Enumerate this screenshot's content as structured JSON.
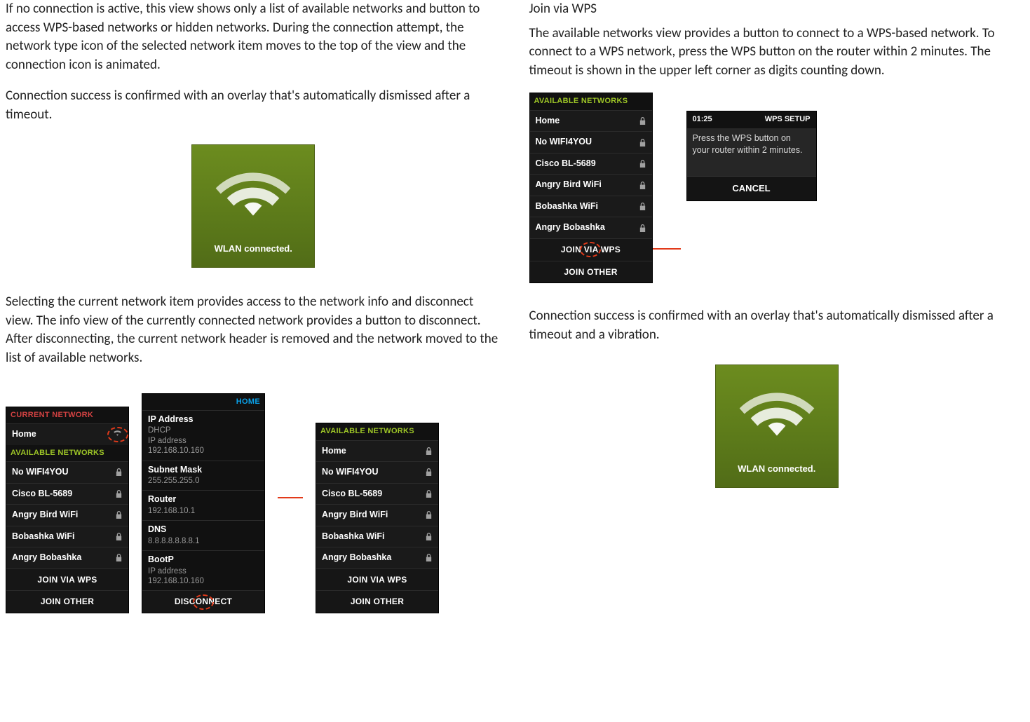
{
  "left": {
    "p1": "If no connection is active, this view shows only a list of available networks and button to access WPS-based networks or hidden networks. During the connection attempt, the network type icon of the selected network item moves to the top of the view and the connection icon is animated.",
    "p2": "Connection success is confirmed with an overlay that's automatically dismissed after a timeout.",
    "p3": "Selecting the current network item provides access to the network info and disconnect view. The info view of the currently connected network provides a button to disconnect. After disconnecting, the current network header is removed and the network moved to the list of available networks."
  },
  "wlan_connected_caption": "WLAN connected.",
  "phone_current": {
    "header_current": "CURRENT NETWORK",
    "current_item": "Home",
    "header_available": "AVAILABLE NETWORKS",
    "items": [
      "No WIFI4YOU",
      "Cisco BL-5689",
      "Angry Bird WiFi",
      "Bobashka WiFi",
      "Angry Bobashka"
    ],
    "btn_wps": "JOIN VIA WPS",
    "btn_other": "JOIN OTHER"
  },
  "phone_info": {
    "header": "HOME",
    "blocks": [
      {
        "label": "IP Address",
        "sub1": "DHCP",
        "sub2": "IP address",
        "sub3": "192.168.10.160"
      },
      {
        "label": "Subnet Mask",
        "sub1": "255.255.255.0"
      },
      {
        "label": "Router",
        "sub1": "192.168.10.1"
      },
      {
        "label": "DNS",
        "sub1": "8.8.8.8.8.8.8.1"
      },
      {
        "label": "BootP",
        "sub1": "IP address",
        "sub2": "192.168.10.160"
      }
    ],
    "btn_disconnect": "DISCONNECT"
  },
  "phone_available": {
    "header": "AVAILABLE  NETWORKS",
    "items": [
      "Home",
      "No WIFI4YOU",
      "Cisco BL-5689",
      "Angry Bird WiFi",
      "Bobashka WiFi",
      "Angry Bobashka"
    ],
    "btn_wps": "JOIN VIA WPS",
    "btn_other": "JOIN OTHER"
  },
  "right": {
    "h": "Join via WPS",
    "p1": "The available networks view provides a button to connect to a WPS-based network. To connect to a WPS network, press the WPS button on the router within 2 minutes. The timeout is shown in the upper left corner as digits counting down.",
    "p2": "Connection success is confirmed with an overlay that's automatically dismissed after a timeout and a vibration."
  },
  "wps": {
    "timer": "01:25",
    "title": "WPS SETUP",
    "msg": "Press the WPS button on your router within 2 minutes.",
    "cancel": "CANCEL"
  }
}
